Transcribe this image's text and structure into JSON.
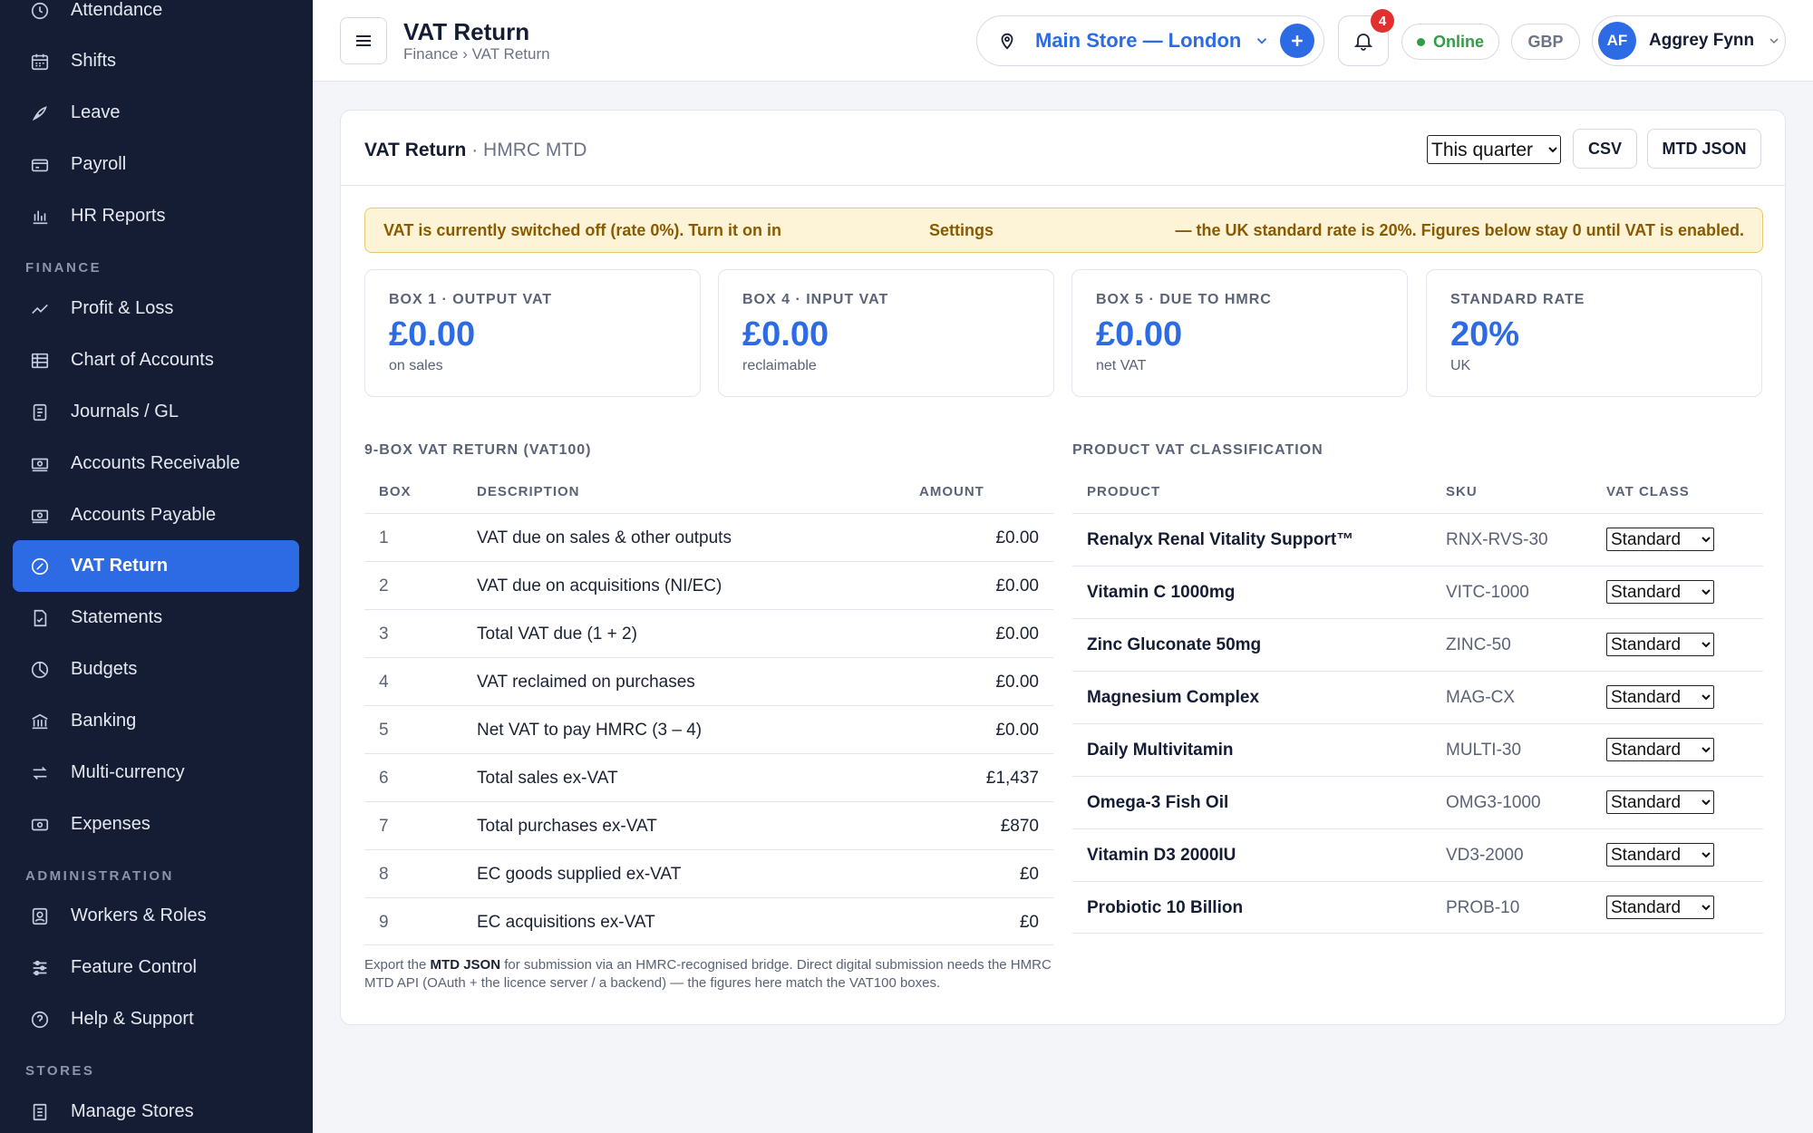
{
  "sidebar": {
    "items": [
      {
        "label": "Attendance",
        "icon": "clock-icon"
      },
      {
        "label": "Shifts",
        "icon": "calendar-icon"
      },
      {
        "label": "Leave",
        "icon": "leaf-icon"
      },
      {
        "label": "Payroll",
        "icon": "wallet-icon"
      },
      {
        "label": "HR Reports",
        "icon": "bar-chart-icon"
      },
      {
        "label": "Profit & Loss",
        "icon": "trend-icon"
      },
      {
        "label": "Chart of Accounts",
        "icon": "grid-icon"
      },
      {
        "label": "Journals / GL",
        "icon": "document-icon"
      },
      {
        "label": "Accounts Receivable",
        "icon": "money-in-icon"
      },
      {
        "label": "Accounts Payable",
        "icon": "money-out-icon"
      },
      {
        "label": "VAT Return",
        "icon": "percent-icon"
      },
      {
        "label": "Statements",
        "icon": "file-check-icon"
      },
      {
        "label": "Budgets",
        "icon": "pie-icon"
      },
      {
        "label": "Banking",
        "icon": "bank-icon"
      },
      {
        "label": "Multi-currency",
        "icon": "exchange-icon"
      },
      {
        "label": "Expenses",
        "icon": "receipt-icon"
      },
      {
        "label": "Workers & Roles",
        "icon": "user-badge-icon"
      },
      {
        "label": "Feature Control",
        "icon": "sliders-icon"
      },
      {
        "label": "Help & Support",
        "icon": "help-icon"
      },
      {
        "label": "Manage Stores",
        "icon": "store-icon"
      }
    ],
    "sections": {
      "finance": "FINANCE",
      "administration": "ADMINISTRATION",
      "stores": "STORES"
    }
  },
  "header": {
    "title": "VAT Return",
    "breadcrumb": "Finance › VAT Return",
    "store": "Main Store — London",
    "notifications": "4",
    "status": "Online",
    "currency": "GBP",
    "user_initials": "AF",
    "user_name": "Aggrey Fynn"
  },
  "card": {
    "title": "VAT Return",
    "subtitle": " · HMRC MTD",
    "period": "This quarter",
    "csv_label": "CSV",
    "mtd_label": "MTD JSON",
    "alert_part1": "VAT is currently switched off (rate 0%). Turn it on in",
    "alert_link": "Settings",
    "alert_part2": "— the UK standard rate is 20%. Figures below stay 0 until VAT is enabled."
  },
  "kpis": [
    {
      "label": "BOX 1 · OUTPUT VAT",
      "value": "£0.00",
      "note": "on sales"
    },
    {
      "label": "BOX 4 · INPUT VAT",
      "value": "£0.00",
      "note": "reclaimable"
    },
    {
      "label": "BOX 5 · DUE TO HMRC",
      "value": "£0.00",
      "note": "net VAT"
    },
    {
      "label": "STANDARD RATE",
      "value": "20%",
      "note": "UK"
    }
  ],
  "vat_table": {
    "title": "9-BOX VAT RETURN (VAT100)",
    "headers": {
      "box": "BOX",
      "desc": "DESCRIPTION",
      "amount": "AMOUNT"
    },
    "rows": [
      {
        "box": "1",
        "desc": "VAT due on sales & other outputs",
        "amount": "£0.00"
      },
      {
        "box": "2",
        "desc": "VAT due on acquisitions (NI/EC)",
        "amount": "£0.00"
      },
      {
        "box": "3",
        "desc": "Total VAT due (1 + 2)",
        "amount": "£0.00"
      },
      {
        "box": "4",
        "desc": "VAT reclaimed on purchases",
        "amount": "£0.00"
      },
      {
        "box": "5",
        "desc": "Net VAT to pay HMRC (3 – 4)",
        "amount": "£0.00"
      },
      {
        "box": "6",
        "desc": "Total sales ex-VAT",
        "amount": "£1,437"
      },
      {
        "box": "7",
        "desc": "Total purchases ex-VAT",
        "amount": "£870"
      },
      {
        "box": "8",
        "desc": "EC goods supplied ex-VAT",
        "amount": "£0"
      },
      {
        "box": "9",
        "desc": "EC acquisitions ex-VAT",
        "amount": "£0"
      }
    ],
    "footnote_a": "Export the ",
    "footnote_b": "MTD JSON",
    "footnote_c": " for submission via an HMRC-recognised bridge. Direct digital submission needs the HMRC MTD API (OAuth + the licence server / a backend) — the figures here match the VAT100 boxes."
  },
  "product_table": {
    "title": "PRODUCT VAT CLASSIFICATION",
    "headers": {
      "product": "PRODUCT",
      "sku": "SKU",
      "vat_class": "VAT CLASS"
    },
    "rows": [
      {
        "product": "Renalyx Renal Vitality Support™",
        "sku": "RNX-RVS-30",
        "vat_class": "Standard"
      },
      {
        "product": "Vitamin C 1000mg",
        "sku": "VITC-1000",
        "vat_class": "Standard"
      },
      {
        "product": "Zinc Gluconate 50mg",
        "sku": "ZINC-50",
        "vat_class": "Standard"
      },
      {
        "product": "Magnesium Complex",
        "sku": "MAG-CX",
        "vat_class": "Standard"
      },
      {
        "product": "Daily Multivitamin",
        "sku": "MULTI-30",
        "vat_class": "Standard"
      },
      {
        "product": "Omega-3 Fish Oil",
        "sku": "OMG3-1000",
        "vat_class": "Standard"
      },
      {
        "product": "Vitamin D3 2000IU",
        "sku": "VD3-2000",
        "vat_class": "Standard"
      },
      {
        "product": "Probiotic 10 Billion",
        "sku": "PROB-10",
        "vat_class": "Standard"
      }
    ]
  },
  "colors": {
    "accent": "#2d6be4",
    "sidebar": "#141d33",
    "online": "#2f9e44",
    "alert_bg": "#fdf3d6",
    "badge": "#e03131"
  }
}
